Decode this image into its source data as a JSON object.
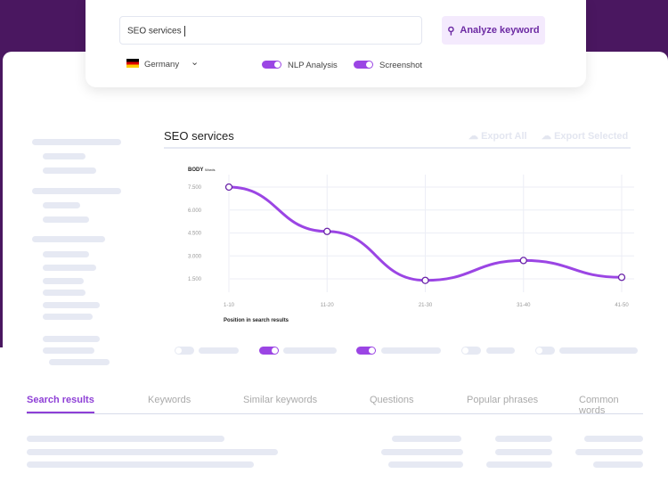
{
  "search": {
    "value": "SEO services",
    "button": "Analyze keyword",
    "country": "Germany",
    "nlp_label": "NLP Analysis",
    "screenshot_label": "Screenshot",
    "nlp_on": true,
    "screenshot_on": true
  },
  "section": {
    "title": "SEO services",
    "export_all": "Export All",
    "export_selected": "Export Selected"
  },
  "tabs": [
    "Search results",
    "Keywords",
    "Similar keywords",
    "Questions",
    "Popular phrases",
    "Common words"
  ],
  "colors": {
    "accent": "#9b45e4",
    "header_bg": "#4a1760"
  },
  "chart_data": {
    "type": "line",
    "title": "BODY",
    "title_suffix": "Words",
    "xlabel": "Position in search results",
    "ylabel": "",
    "categories": [
      "1-10",
      "11-20",
      "21-30",
      "31-40",
      "41-50"
    ],
    "values": [
      7500,
      4600,
      1400,
      2700,
      1600
    ],
    "yticks": [
      "7.500",
      "6.000",
      "4.500",
      "3.000",
      "1.500"
    ],
    "ytick_values": [
      7500,
      6000,
      4500,
      3000,
      1500
    ],
    "ylim": [
      0,
      8500
    ],
    "grid": true
  }
}
